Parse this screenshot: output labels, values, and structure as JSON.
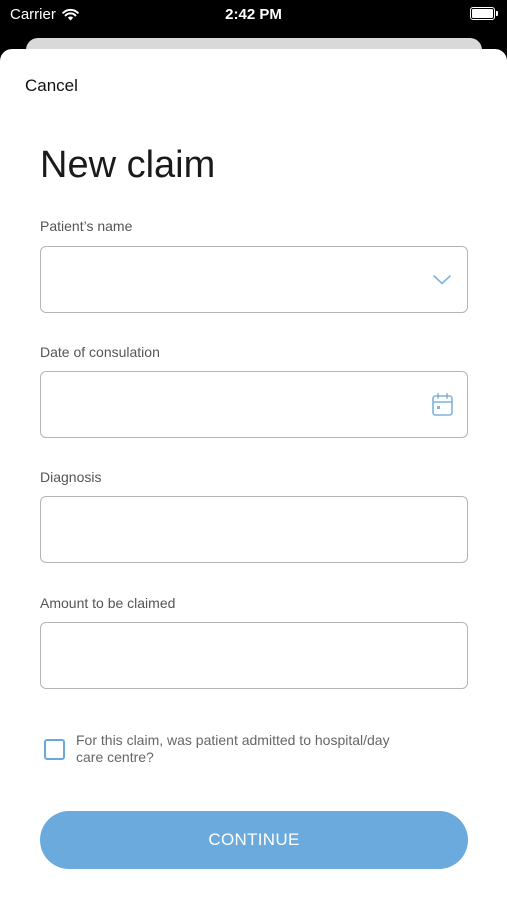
{
  "status_bar": {
    "carrier": "Carrier",
    "time": "2:42 PM"
  },
  "header": {
    "cancel_label": "Cancel",
    "title": "New claim"
  },
  "form": {
    "patient_name": {
      "label": "Patient’s name",
      "value": ""
    },
    "date": {
      "label": "Date of consulation",
      "value": ""
    },
    "diagnosis": {
      "label": "Diagnosis",
      "value": ""
    },
    "amount": {
      "label": "Amount to be claimed",
      "value": ""
    },
    "admitted": {
      "label": "For this claim, was patient admitted to hospital/day care centre?",
      "checked": false
    }
  },
  "actions": {
    "continue_label": "CONTINUE"
  },
  "colors": {
    "accent": "#6aaadd",
    "icon": "#7fb3dc",
    "border": "#b5b5b5"
  },
  "icons": {
    "dropdown": "chevron-down-icon",
    "date": "calendar-icon",
    "wifi": "wifi-icon",
    "battery": "battery-icon"
  }
}
